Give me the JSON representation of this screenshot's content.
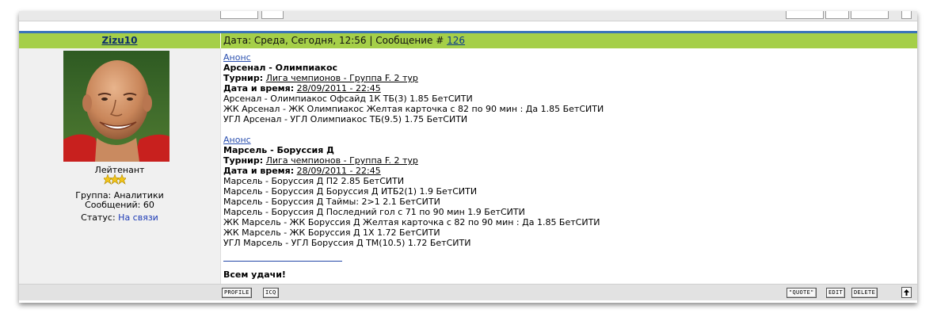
{
  "author": {
    "name": "Zizu10",
    "rank": "Лейтенант",
    "group": "Группа: Аналитики",
    "messages": "Сообщений: 60",
    "status_label": "Статус:",
    "status_value": "На связи"
  },
  "header": {
    "date_text": "Дата: Среда, Сегодня, 12:56 | Сообщение #",
    "message_number": "126"
  },
  "post": {
    "block1": {
      "anons": "Анонс",
      "match": "Арсенал - Олимпиакос",
      "tournament_label": "Турнир:",
      "tournament": "Лига чемпионов - Группа F. 2 тур",
      "datetime_label": "Дата и время:",
      "datetime": "28/09/2011 - 22:45",
      "lines": [
        "Арсенал - Олимпиакос Офсайд 1К ТБ(3) 1.85 БетСИТИ",
        "ЖК Арсенал - ЖК Олимпиакос Желтая карточка с 82 по 90 мин : Да 1.85 БетСИТИ",
        "УГЛ Арсенал - УГЛ Олимпиакос ТБ(9.5) 1.75 БетСИТИ"
      ]
    },
    "block2": {
      "anons": "Анонс",
      "match": "Марсель - Боруссия Д",
      "tournament_label": "Турнир:",
      "tournament": "Лига чемпионов - Группа F. 2 тур",
      "datetime_label": "Дата и время:",
      "datetime": "28/09/2011 - 22:45",
      "lines": [
        "Марсель - Боруссия Д П2 2.85 БетСИТИ",
        "Марсель - Боруссия Д Боруссия Д ИТБ2(1) 1.9 БетСИТИ",
        "Марсель - Боруссия Д Таймы: 2>1 2.1 БетСИТИ",
        "Марсель - Боруссия Д Последний гол с 71 по 90 мин 1.9 БетСИТИ",
        "ЖК Марсель - ЖК Боруссия Д Желтая карточка с 82 по 90 мин : Да 1.85 БетСИТИ",
        "ЖК Марсель - ЖК Боруссия Д 1X 1.72 БетСИТИ",
        "УГЛ Марсель - УГЛ Боруссия Д ТМ(10.5) 1.72 БетСИТИ"
      ]
    },
    "signature": "Всем удачи!"
  },
  "footer": {
    "profile": "PROFILE",
    "icq": "ICQ",
    "quote": "\"QUOTE\"",
    "edit": "EDIT",
    "delete": "DELETE"
  },
  "colors": {
    "header_green": "#a5cf48",
    "header_blue_line": "#3a73b9",
    "link_blue": "#2a4faf"
  }
}
